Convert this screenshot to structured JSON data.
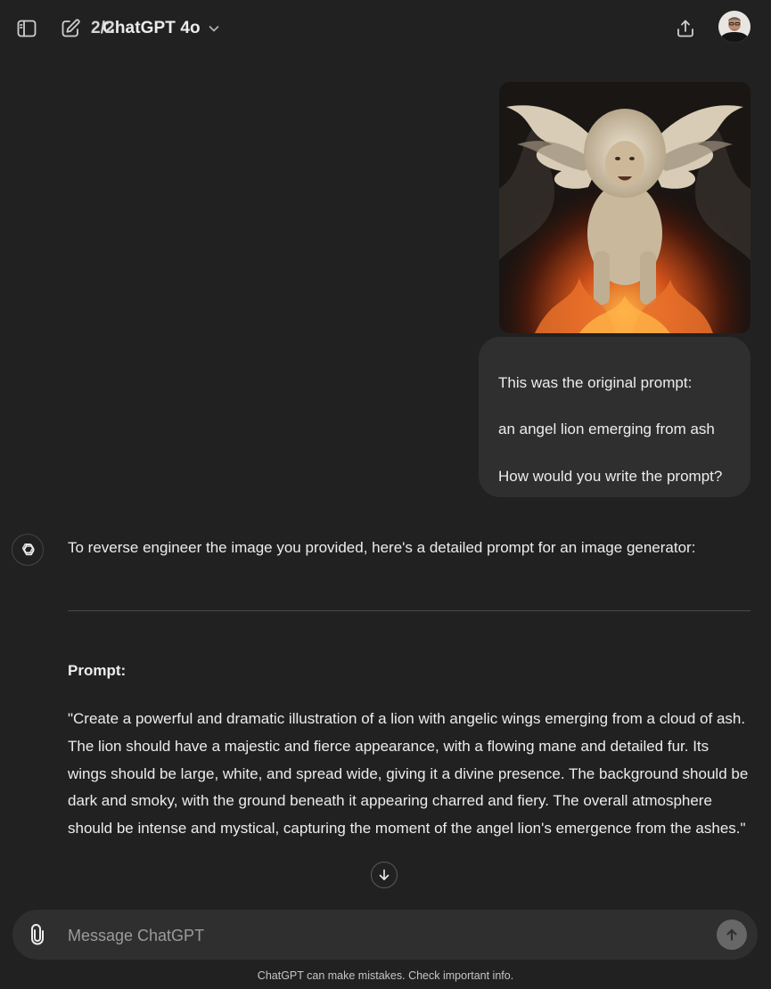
{
  "header": {
    "model_counter": "2/2",
    "model_name": "ChatGPT 4o",
    "icons": {
      "sidebar": "sidebar-toggle-icon",
      "new_chat": "new-chat-icon",
      "model_chevron": "chevron-down-icon",
      "share": "share-icon",
      "avatar": "user-avatar"
    }
  },
  "conversation": {
    "user_message": {
      "image_alt": "angel lion emerging from ash",
      "lines": [
        "This was the original prompt:",
        "an angel lion emerging from ash",
        "How would you write the prompt?"
      ]
    },
    "assistant_message": {
      "intro": "To reverse engineer the image you provided, here's a detailed prompt for an image generator:",
      "heading": "Prompt:",
      "body": "\"Create a powerful and dramatic illustration of a lion with angelic wings emerging from a cloud of ash. The lion should have a majestic and fierce appearance, with a flowing mane and detailed fur. Its wings should be large, white, and spread wide, giving it a divine presence. The background should be dark and smoky, with the ground beneath it appearing charred and fiery. The overall atmosphere should be intense and mystical, capturing the moment of the angel lion's emergence from the ashes.\""
    }
  },
  "composer": {
    "placeholder": "Message ChatGPT",
    "value": ""
  },
  "footer": {
    "disclaimer": "ChatGPT can make mistakes. Check important info."
  },
  "colors": {
    "background": "#212121",
    "bubble": "#2f2f2f",
    "text": "#ececec",
    "muted": "#9b9b9b",
    "send_button": "#676767"
  }
}
